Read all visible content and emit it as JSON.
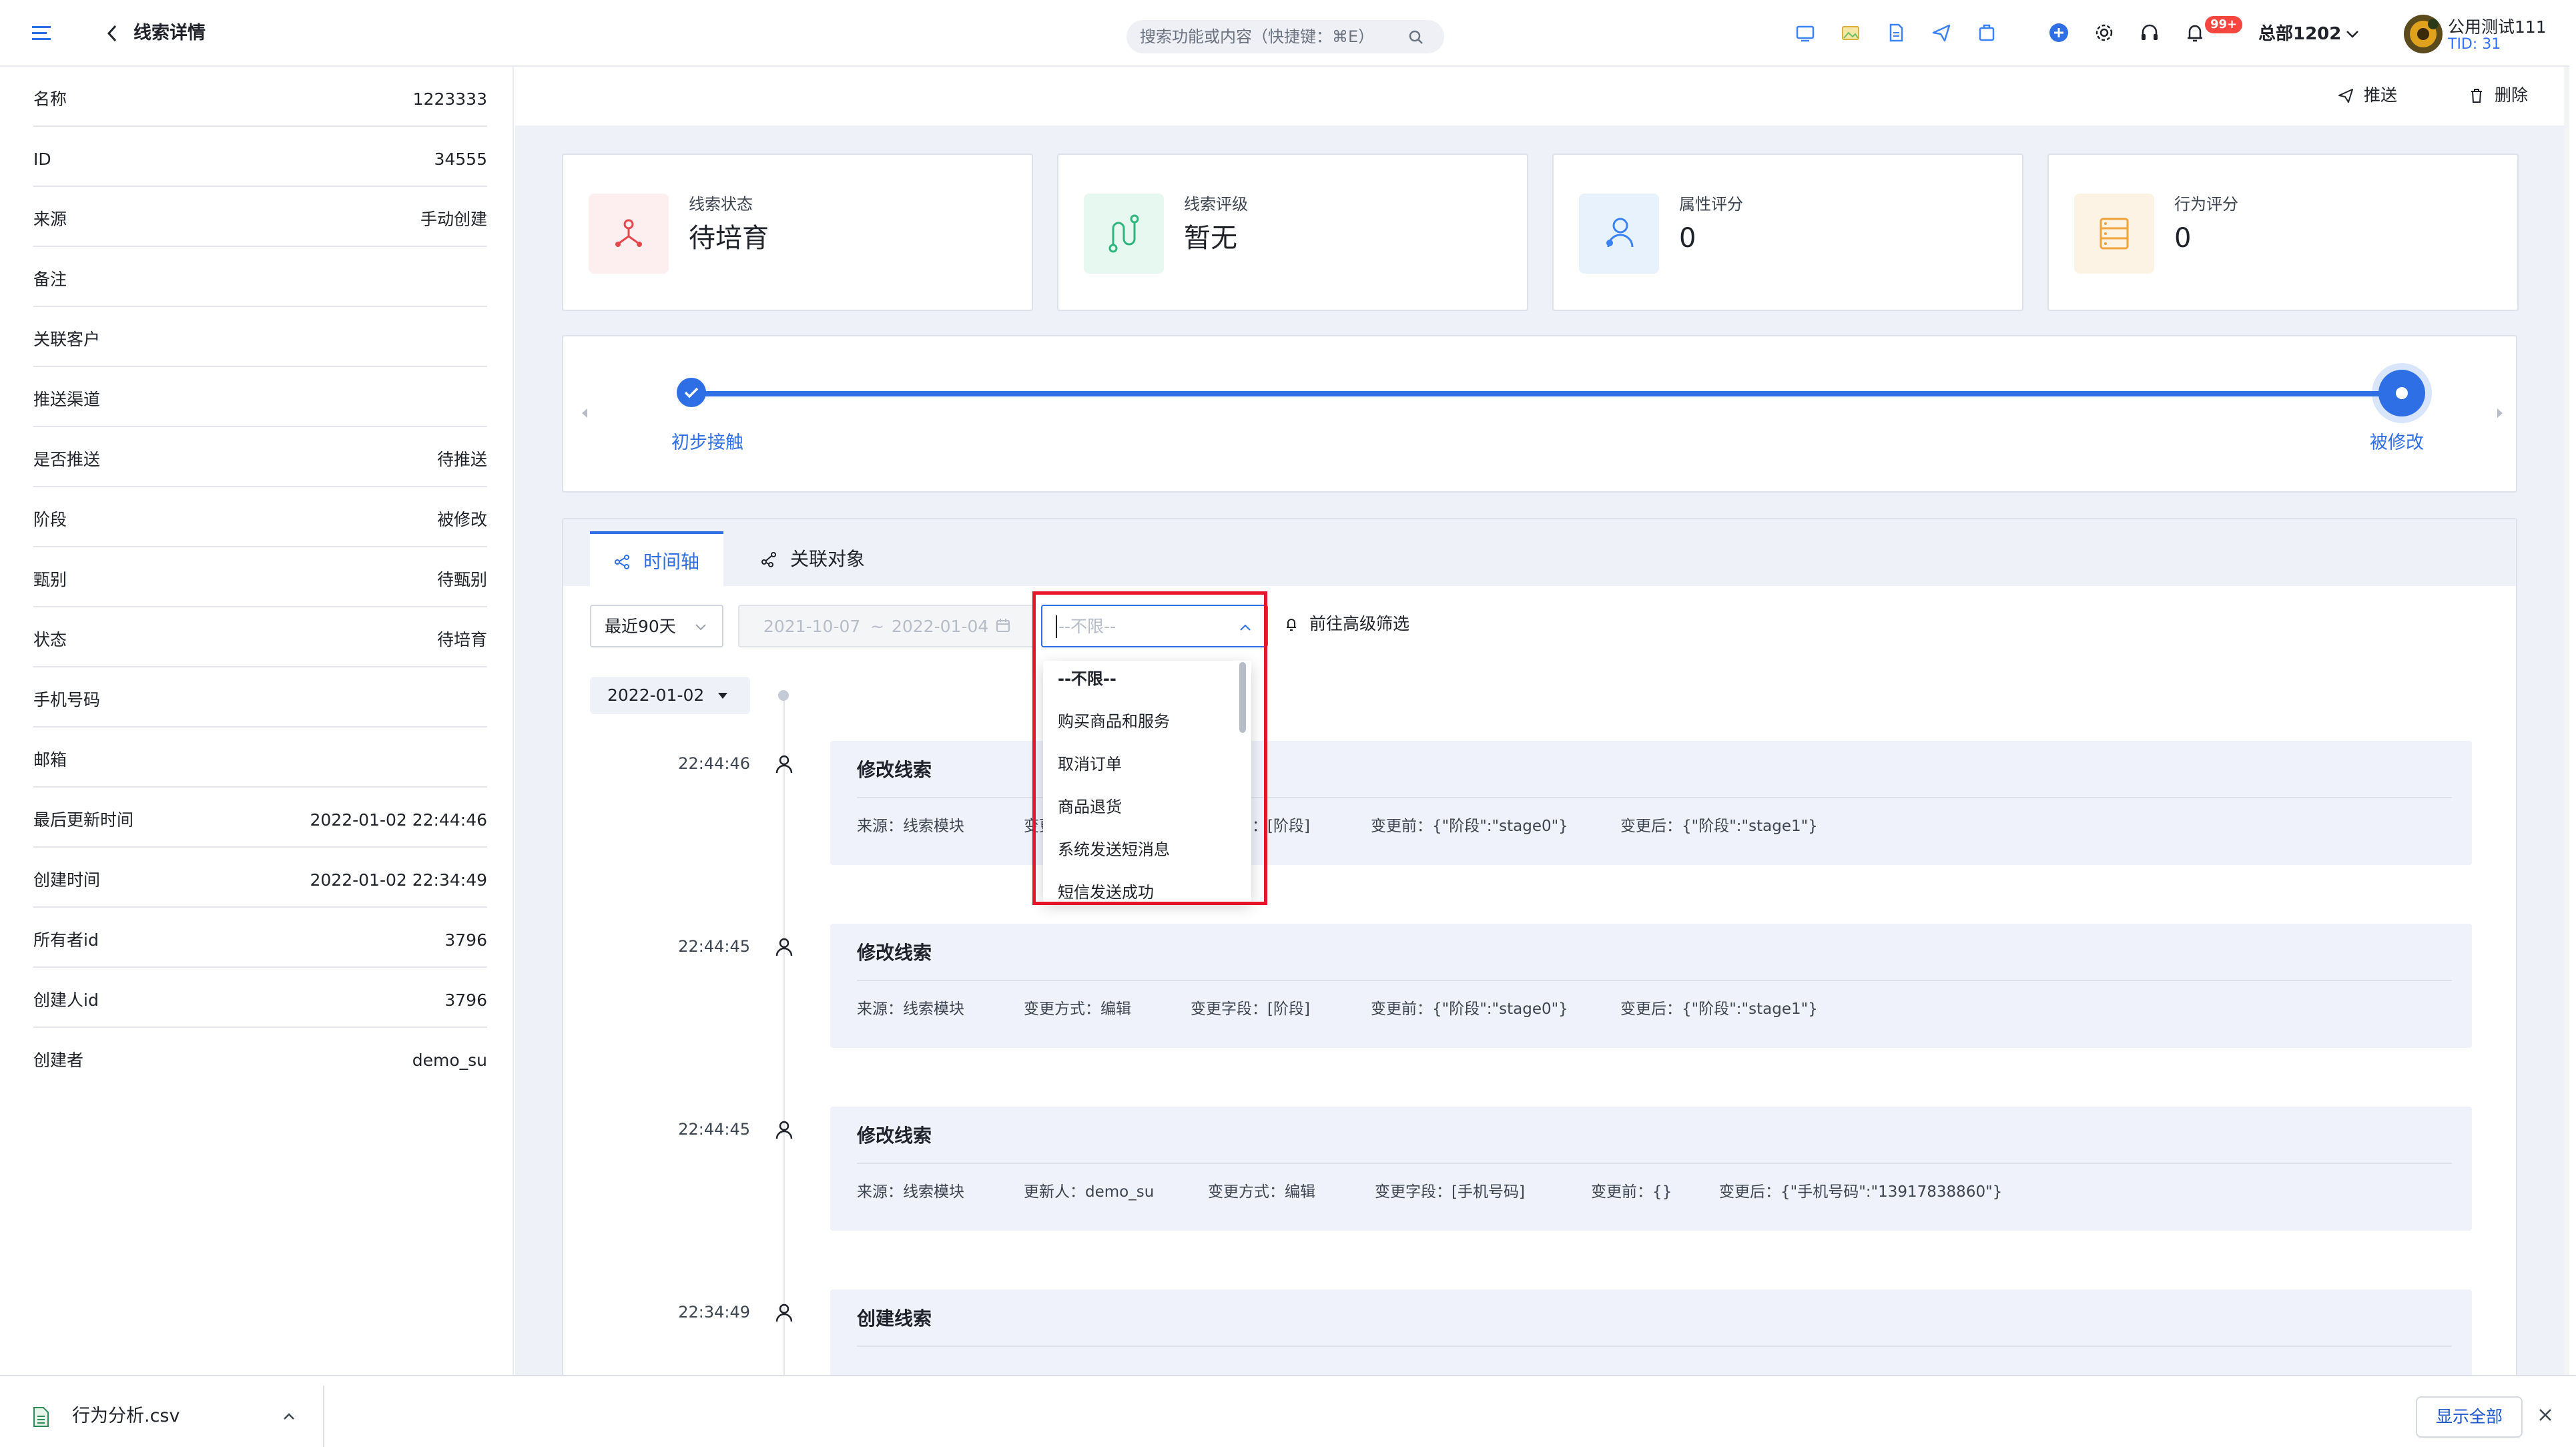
{
  "header": {
    "title": "线索详情",
    "search_placeholder": "搜索功能或内容（快捷键：⌘E）",
    "notification_badge": "99+",
    "org_name": "总部1202",
    "user_name": "公用测试111",
    "user_tid": "TID: 31",
    "icons": [
      "menu-icon",
      "back-icon",
      "search-icon",
      "monitor-icon",
      "image-icon",
      "document-icon",
      "send-icon",
      "box-icon",
      "plus-circle-icon",
      "gear-icon",
      "headset-icon",
      "bell-icon",
      "chevron-down-icon"
    ]
  },
  "sidebar": {
    "rows": [
      {
        "label": "名称",
        "value": "1223333"
      },
      {
        "label": "ID",
        "value": "34555"
      },
      {
        "label": "来源",
        "value": "手动创建"
      },
      {
        "label": "备注",
        "value": ""
      },
      {
        "label": "关联客户",
        "value": ""
      },
      {
        "label": "推送渠道",
        "value": ""
      },
      {
        "label": "是否推送",
        "value": "待推送"
      },
      {
        "label": "阶段",
        "value": "被修改"
      },
      {
        "label": "甄别",
        "value": "待甄别"
      },
      {
        "label": "状态",
        "value": "待培育"
      },
      {
        "label": "手机号码",
        "value": ""
      },
      {
        "label": "邮箱",
        "value": ""
      },
      {
        "label": "最后更新时间",
        "value": "2022-01-02 22:44:46"
      },
      {
        "label": "创建时间",
        "value": "2022-01-02 22:34:49"
      },
      {
        "label": "所有者id",
        "value": "3796"
      },
      {
        "label": "创建人id",
        "value": "3796"
      },
      {
        "label": "创建者",
        "value": "demo_su"
      }
    ]
  },
  "actions": {
    "push": "推送",
    "delete": "删除"
  },
  "cards": [
    {
      "label": "线索状态",
      "value": "待培育",
      "icon": "funnel-icon",
      "bg": "#fdeef0",
      "color": "#e5484d"
    },
    {
      "label": "线索评级",
      "value": "暂无",
      "icon": "rating-icon",
      "bg": "#e7f8f1",
      "color": "#2eb67d"
    },
    {
      "label": "属性评分",
      "value": "0",
      "icon": "person-score-icon",
      "bg": "#e8f2fd",
      "color": "#3b82f6"
    },
    {
      "label": "行为评分",
      "value": "0",
      "icon": "list-score-icon",
      "bg": "#fdf3e4",
      "color": "#f0a33a"
    }
  ],
  "stages": {
    "first": "初步接触",
    "last": "被修改"
  },
  "tabs": {
    "timeline": "时间轴",
    "related": "关联对象"
  },
  "filters": {
    "range": "最近90天",
    "date_start": "2021-10-07",
    "date_sep": "~",
    "date_end": "2022-01-04",
    "type_placeholder": "--不限--",
    "advanced": "前往高级筛选"
  },
  "dropdown": {
    "options": [
      "--不限--",
      "购买商品和服务",
      "取消订单",
      "商品退货",
      "系统发送短消息",
      "短信发送成功"
    ]
  },
  "timeline": {
    "date": "2022-01-02",
    "entries": [
      {
        "time": "22:44:46",
        "title": "修改线索",
        "meta": [
          "来源：线索模块",
          "变更方式：编辑",
          "变更字段：[阶段]",
          "变更前：{\"阶段\":\"stage0\"}",
          "变更后：{\"阶段\":\"stage1\"}"
        ]
      },
      {
        "time": "22:44:45",
        "title": "修改线索",
        "meta": [
          "来源：线索模块",
          "变更方式：编辑",
          "变更字段：[阶段]",
          "变更前：{\"阶段\":\"stage0\"}",
          "变更后：{\"阶段\":\"stage1\"}"
        ]
      },
      {
        "time": "22:44:45",
        "title": "修改线索",
        "meta": [
          "来源：线索模块",
          "更新人：demo_su",
          "变更方式：编辑",
          "变更字段：[手机号码]",
          "变更前：{}",
          "变更后：{\"手机号码\":\"13917838860\"}"
        ]
      },
      {
        "time": "22:34:49",
        "title": "创建线索",
        "meta": []
      }
    ]
  },
  "download_bar": {
    "file_name": "行为分析.csv",
    "show_all": "显示全部"
  },
  "colors": {
    "accent": "#2f6fe6",
    "highlight_box": "#e6152a",
    "badge": "#f5463f"
  }
}
